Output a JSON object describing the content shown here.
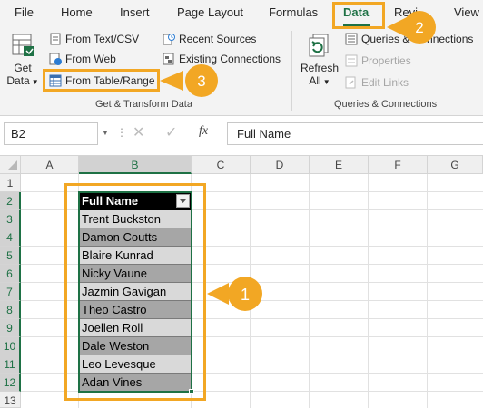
{
  "tabs": [
    "File",
    "Home",
    "Insert",
    "Page Layout",
    "Formulas",
    "Data",
    "Revi",
    "View"
  ],
  "ribbon": {
    "get_transform": {
      "get_data_line1": "Get",
      "get_data_line2": "Data",
      "from_text_csv": "From Text/CSV",
      "from_web": "From Web",
      "from_table_range": "From Table/Range",
      "recent_sources": "Recent Sources",
      "existing_connections": "Existing Connections",
      "group_label": "Get & Transform Data"
    },
    "queries": {
      "refresh_line1": "Refresh",
      "refresh_line2": "All",
      "queries_connections": "Queries & Connections",
      "properties": "Properties",
      "edit_links": "Edit Links",
      "group_label": "Queries & Connections"
    }
  },
  "formula_bar": {
    "name_box": "B2",
    "fx": "fx",
    "content": "Full Name"
  },
  "grid": {
    "columns": [
      "A",
      "B",
      "C",
      "D",
      "E",
      "F",
      "G"
    ],
    "rows": [
      "1",
      "2",
      "3",
      "4",
      "5",
      "6",
      "7",
      "8",
      "9",
      "10",
      "11",
      "12",
      "13"
    ],
    "table_header": "Full Name",
    "names": [
      "Trent Buckston",
      "Damon Coutts",
      "Blaire Kunrad",
      "Nicky Vaune",
      "Jazmin Gavigan",
      "Theo Castro",
      "Joellen Roll",
      "Dale Weston",
      "Leo Levesque",
      "Adan Vines"
    ]
  },
  "callouts": {
    "one": "1",
    "two": "2",
    "three": "3"
  },
  "colors": {
    "accent": "#1e7145",
    "highlight": "#f2a724"
  }
}
